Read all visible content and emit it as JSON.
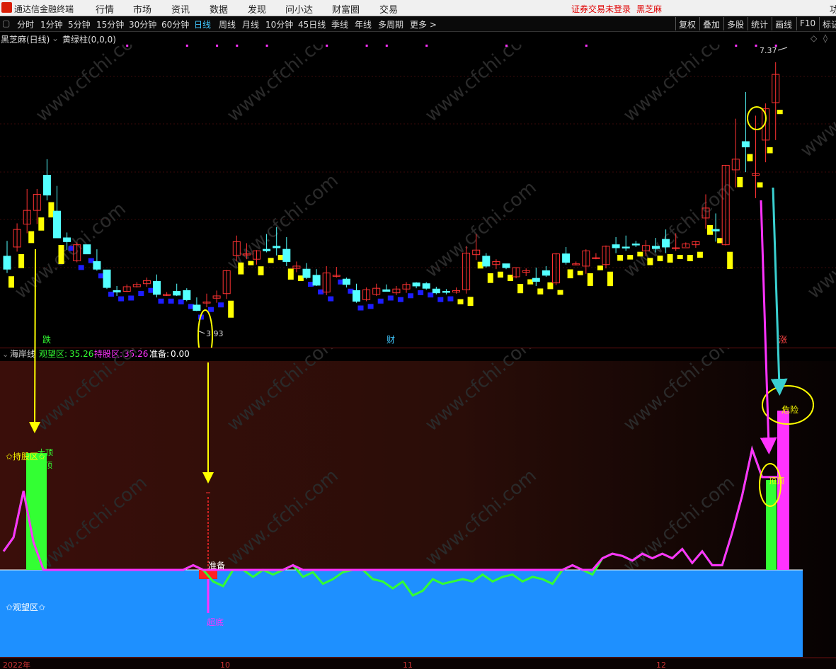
{
  "menubar": {
    "app_title": "通达信金融终端",
    "items": [
      "行情",
      "市场",
      "资讯",
      "数据",
      "发现",
      "问小达",
      "财富圈",
      "交易"
    ],
    "login_status": "证券交易未登录",
    "stock_name": "黑芝麻",
    "edge_label": "功"
  },
  "toolbar": {
    "periods": [
      "分时",
      "1分钟",
      "5分钟",
      "15分钟",
      "30分钟",
      "60分钟",
      "日线",
      "周线",
      "月线",
      "10分钟",
      "45日线",
      "季线",
      "年线",
      "多周期",
      "更多 >"
    ],
    "active": "日线",
    "right_buttons": [
      "复权",
      "叠加",
      "多股",
      "统计",
      "画线",
      "F10",
      "标记"
    ]
  },
  "main_panel": {
    "title": "黑芝麻(日线)",
    "indicator": "黄绿柱(0,0,0)",
    "price_high_label": "7.37",
    "price_low_label": "3.93",
    "markers": [
      "跌",
      "财",
      "涨"
    ]
  },
  "sub_panel": {
    "title": "海岸线",
    "legend": [
      {
        "label": "观望区:",
        "value": "35.26",
        "color": "#33ff33"
      },
      {
        "label": "持股区:",
        "value": "35.26",
        "color": "#ff33ff"
      },
      {
        "label": "准备:",
        "value": "0.00",
        "color": "#ffffff"
      }
    ],
    "zone_hold": "✩持股区✩",
    "zone_watch": "✩观望区✩",
    "labels": {
      "top_a": "大顶",
      "top_b": "顶",
      "prepare": "准备",
      "bottom": "超底",
      "danger": "危险",
      "top_right": "顶顶"
    }
  },
  "xaxis": {
    "labels": [
      "2022年",
      "10",
      "11",
      "12"
    ]
  },
  "watermark": "www.cfchi.com",
  "colors": {
    "up": "#ff3232",
    "down": "#54ffff",
    "yellow_bar": "#ffff00",
    "blue_bar": "#1d1dff",
    "hold_line": "#ff33ff",
    "watch_line": "#33ff33",
    "watch_zone": "#1e90ff",
    "annotation_yellow": "#ffff00",
    "annotation_cyan": "#3ad0d0",
    "annotation_magenta": "#ff33ff"
  },
  "chart_data": [
    {
      "type": "candlestick",
      "title": "黑芝麻(日线)",
      "y_labels": {
        "high": 7.37,
        "low": 3.93
      },
      "ylim": [
        3.8,
        7.6
      ],
      "candles_ohlc": [
        [
          4.83,
          5.03,
          4.61,
          4.66
        ],
        [
          4.95,
          5.26,
          4.89,
          5.18
        ],
        [
          5.25,
          5.71,
          5.13,
          5.43
        ],
        [
          5.43,
          5.71,
          5.25,
          5.64
        ],
        [
          5.89,
          6.1,
          5.56,
          5.63
        ],
        [
          5.42,
          5.75,
          5.07,
          5.07
        ],
        [
          5.07,
          5.14,
          4.91,
          5.02
        ],
        [
          4.77,
          5.01,
          4.75,
          4.98
        ],
        [
          4.98,
          4.98,
          4.86,
          4.86
        ],
        [
          4.76,
          4.92,
          4.64,
          4.66
        ],
        [
          4.65,
          4.65,
          4.4,
          4.42
        ],
        [
          4.38,
          4.44,
          4.31,
          4.36
        ],
        [
          4.37,
          4.46,
          4.36,
          4.43
        ],
        [
          4.43,
          4.49,
          4.42,
          4.46
        ],
        [
          4.47,
          4.55,
          4.43,
          4.51
        ],
        [
          4.5,
          4.59,
          4.29,
          4.33
        ],
        [
          4.33,
          4.36,
          4.31,
          4.33
        ],
        [
          4.37,
          4.47,
          4.31,
          4.32
        ],
        [
          4.38,
          4.41,
          4.24,
          4.26
        ],
        [
          4.19,
          4.29,
          4.11,
          4.12
        ],
        [
          4.22,
          4.34,
          4.16,
          4.23
        ],
        [
          4.28,
          4.38,
          4.22,
          4.31
        ],
        [
          4.34,
          4.65,
          4.27,
          4.64
        ],
        [
          4.84,
          5.1,
          4.77,
          5.02
        ],
        [
          4.86,
          5.0,
          4.79,
          4.86
        ],
        [
          4.79,
          4.91,
          4.72,
          4.9
        ],
        [
          4.92,
          5.12,
          4.88,
          4.9
        ],
        [
          4.96,
          5.21,
          4.84,
          4.94
        ],
        [
          4.92,
          5.08,
          4.7,
          4.76
        ],
        [
          4.67,
          4.76,
          4.62,
          4.7
        ],
        [
          4.66,
          4.74,
          4.53,
          4.55
        ],
        [
          4.58,
          4.66,
          4.44,
          4.45
        ],
        [
          4.36,
          4.7,
          4.32,
          4.61
        ],
        [
          4.58,
          4.69,
          4.55,
          4.58
        ],
        [
          4.53,
          4.55,
          4.42,
          4.46
        ],
        [
          4.38,
          4.47,
          4.22,
          4.24
        ],
        [
          4.26,
          4.42,
          4.24,
          4.39
        ],
        [
          4.33,
          4.47,
          4.31,
          4.41
        ],
        [
          4.39,
          4.46,
          4.37,
          4.37
        ],
        [
          4.35,
          4.44,
          4.32,
          4.4
        ],
        [
          4.4,
          4.49,
          4.35,
          4.46
        ],
        [
          4.48,
          4.49,
          4.41,
          4.44
        ],
        [
          4.47,
          4.49,
          4.39,
          4.41
        ],
        [
          4.4,
          4.43,
          4.33,
          4.35
        ],
        [
          4.37,
          4.4,
          4.33,
          4.36
        ],
        [
          4.36,
          4.42,
          4.34,
          4.38
        ],
        [
          4.39,
          4.96,
          4.34,
          4.87
        ],
        [
          4.85,
          5.12,
          4.78,
          4.91
        ],
        [
          4.83,
          4.87,
          4.68,
          4.7
        ],
        [
          4.72,
          4.79,
          4.66,
          4.76
        ],
        [
          4.73,
          4.73,
          4.66,
          4.68
        ],
        [
          4.56,
          4.68,
          4.54,
          4.68
        ],
        [
          4.62,
          4.67,
          4.57,
          4.64
        ],
        [
          4.54,
          4.68,
          4.44,
          4.5
        ],
        [
          4.64,
          4.7,
          4.56,
          4.58
        ],
        [
          4.48,
          4.87,
          4.45,
          4.86
        ],
        [
          4.86,
          4.95,
          4.72,
          4.75
        ],
        [
          4.73,
          4.76,
          4.71,
          4.73
        ],
        [
          4.7,
          4.92,
          4.6,
          4.9
        ],
        [
          4.8,
          4.87,
          4.79,
          4.81
        ],
        [
          4.72,
          4.97,
          4.67,
          4.96
        ],
        [
          4.98,
          5.08,
          4.87,
          4.94
        ],
        [
          4.95,
          5.1,
          4.9,
          4.94
        ],
        [
          4.99,
          5.03,
          4.95,
          4.98
        ],
        [
          4.9,
          5.04,
          4.83,
          4.97
        ],
        [
          4.96,
          5.07,
          4.88,
          4.93
        ],
        [
          5.05,
          5.18,
          4.87,
          4.95
        ],
        [
          4.94,
          5.13,
          4.9,
          4.94
        ],
        [
          4.94,
          5.01,
          4.95,
          4.99
        ],
        [
          4.98,
          5.03,
          4.94,
          5.02
        ],
        [
          5.33,
          5.64,
          5.19,
          5.46
        ],
        [
          5.18,
          5.39,
          5.02,
          5.16
        ],
        [
          4.98,
          6.02,
          4.97,
          6.02
        ],
        [
          5.96,
          6.63,
          5.73,
          6.1
        ],
        [
          6.33,
          6.98,
          5.93,
          6.26
        ],
        [
          5.89,
          6.67,
          5.59,
          5.91
        ],
        [
          6.35,
          6.83,
          6.06,
          6.76
        ],
        [
          6.84,
          7.37,
          6.35,
          7.21
        ]
      ],
      "indicator_bars": [
        {
          "name": "黄绿柱 yellow",
          "color": "#ffff00",
          "values_index_range": "early and from index 22 onward"
        },
        {
          "name": "黄绿柱 blue",
          "color": "#1d1dff",
          "values_index_range": "index 6-21 and 30-44"
        }
      ]
    },
    {
      "type": "line",
      "title": "海岸线",
      "ylim": [
        -10,
        80
      ],
      "baseline": 0,
      "series": [
        {
          "name": "持股区",
          "values": [
            8,
            14,
            34,
            12,
            0,
            0,
            0,
            0,
            0,
            0,
            0,
            0,
            0,
            0,
            0,
            0,
            0,
            0,
            0,
            2,
            0,
            -5,
            -7,
            0,
            0,
            -3,
            0,
            -2,
            0,
            2,
            -3,
            -1,
            -6,
            -4,
            -1,
            0,
            0,
            -4,
            -5,
            -8,
            -5,
            -11,
            -9,
            -4,
            -6,
            -5,
            -4,
            -5,
            -2,
            -5,
            -3,
            -2,
            -5,
            -3,
            -4,
            -6,
            0,
            2,
            0,
            -2,
            5,
            7,
            6,
            4,
            7,
            5,
            7,
            5,
            9,
            3,
            8,
            2,
            2,
            16,
            32,
            52,
            40,
            40,
            40
          ]
        },
        {
          "name": "观望区",
          "values": [
            8,
            14,
            34,
            12,
            0,
            0,
            0,
            0,
            0,
            0,
            0,
            0,
            0,
            0,
            0,
            0,
            0,
            0,
            0,
            2,
            0,
            -5,
            -7,
            0,
            0,
            -3,
            0,
            -2,
            0,
            2,
            -3,
            -1,
            -6,
            -4,
            -1,
            0,
            0,
            -4,
            -5,
            -8,
            -5,
            -11,
            -9,
            -4,
            -6,
            -5,
            -4,
            -5,
            -2,
            -5,
            -3,
            -2,
            -5,
            -3,
            -4,
            -6,
            0,
            2,
            0,
            -2,
            5,
            7,
            6,
            4,
            7,
            5,
            7,
            5,
            9,
            3,
            8,
            2,
            2,
            16,
            32,
            52,
            40,
            40,
            40
          ]
        }
      ],
      "legend": {
        "观望区": 35.26,
        "持股区": 35.26,
        "准备": 0.0
      }
    }
  ]
}
